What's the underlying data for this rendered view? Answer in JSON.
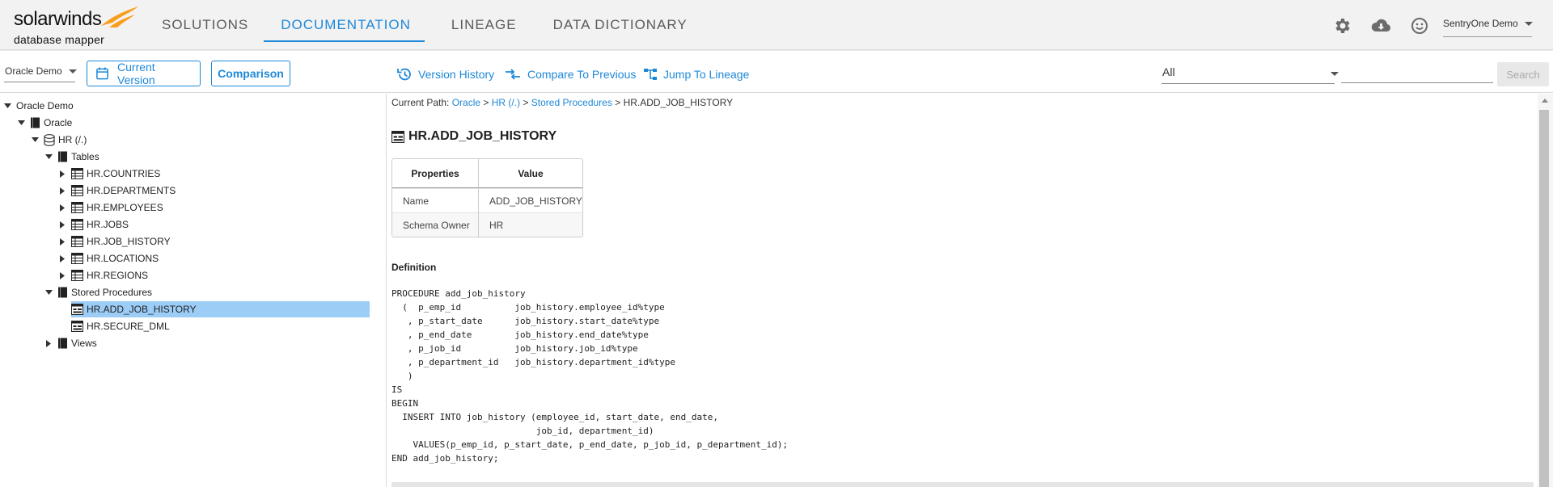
{
  "app": {
    "logo_main": "solarwinds",
    "logo_sub": "database mapper"
  },
  "nav": {
    "items": [
      {
        "label": "SOLUTIONS"
      },
      {
        "label": "DOCUMENTATION",
        "active": true
      },
      {
        "label": "LINEAGE"
      },
      {
        "label": "DATA DICTIONARY"
      }
    ]
  },
  "header_icons": [
    "gear-icon",
    "cloud-download-icon",
    "smiley-icon"
  ],
  "user": {
    "label": "SentryOne Demo"
  },
  "toolbar": {
    "database": "Oracle Demo",
    "current_version": "Current Version",
    "comparison": "Comparison",
    "version_history": "Version History",
    "compare_to_previous": "Compare To Previous",
    "jump_to_lineage": "Jump To Lineage",
    "filter_value": "All",
    "search_value": "",
    "search_button": "Search"
  },
  "tree": {
    "root": "Oracle Demo",
    "server": "Oracle",
    "schema": "HR (/.)",
    "tables_folder": "Tables",
    "tables": [
      "HR.COUNTRIES",
      "HR.DEPARTMENTS",
      "HR.EMPLOYEES",
      "HR.JOBS",
      "HR.JOB_HISTORY",
      "HR.LOCATIONS",
      "HR.REGIONS"
    ],
    "procs_folder": "Stored Procedures",
    "procs": [
      "HR.ADD_JOB_HISTORY",
      "HR.SECURE_DML"
    ],
    "views_folder": "Views"
  },
  "content": {
    "path_label": "Current Path:",
    "path": [
      "Oracle",
      "HR (/.)",
      "Stored Procedures"
    ],
    "path_current": "HR.ADD_JOB_HISTORY",
    "separator": ">",
    "title": "HR.ADD_JOB_HISTORY",
    "props_headers": [
      "Properties",
      "Value"
    ],
    "props_rows": [
      [
        "Name",
        "ADD_JOB_HISTORY"
      ],
      [
        "Schema Owner",
        "HR"
      ]
    ],
    "definition_label": "Definition",
    "definition": "PROCEDURE add_job_history\n  (  p_emp_id          job_history.employee_id%type\n   , p_start_date      job_history.start_date%type\n   , p_end_date        job_history.end_date%type\n   , p_job_id          job_history.job_id%type\n   , p_department_id   job_history.department_id%type\n   )\nIS\nBEGIN\n  INSERT INTO job_history (employee_id, start_date, end_date,\n                           job_id, department_id)\n    VALUES(p_emp_id, p_start_date, p_end_date, p_job_id, p_department_id);\nEND add_job_history;"
  },
  "colors": {
    "accent": "#1e88d8",
    "selected_row": "#9ccdf7",
    "logo_orange": "#f99d1c"
  }
}
